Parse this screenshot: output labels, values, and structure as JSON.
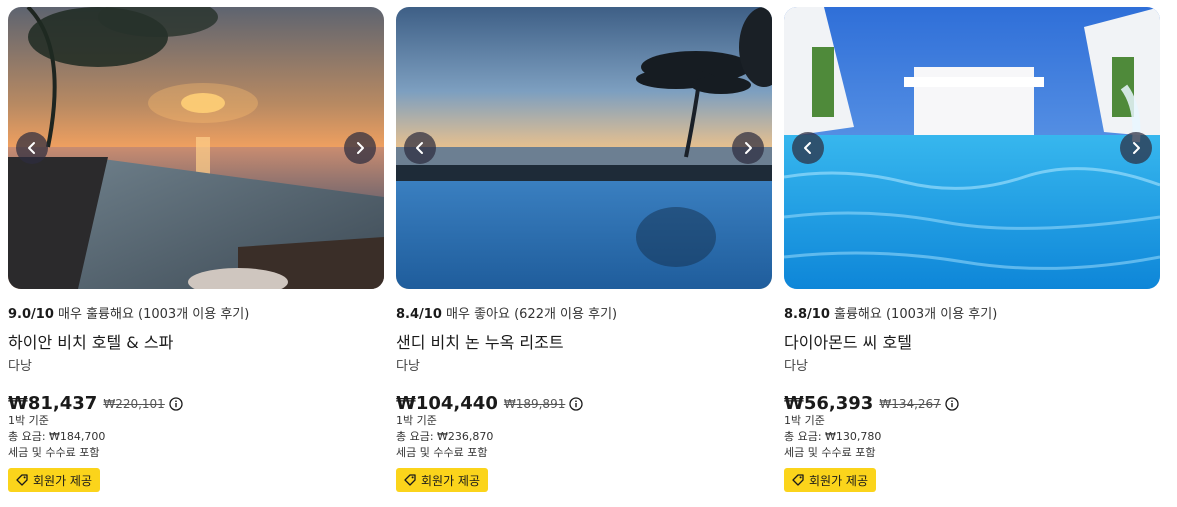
{
  "cards": [
    {
      "score": "9.0/10",
      "rating_text": "매우 훌륭해요 (1003개 이용 후기)",
      "name": "하이안 비치 호텔 & 스파",
      "city": "다낭",
      "price": "₩81,437",
      "old_price": "₩220,101",
      "per_night": "1박 기준",
      "total": "총 요금: ₩184,700",
      "tax_note": "세금 및 수수료 포함",
      "badge": "회원가 제공"
    },
    {
      "score": "8.4/10",
      "rating_text": "매우 좋아요 (622개 이용 후기)",
      "name": "샌디 비치 논 누옥 리조트",
      "city": "다낭",
      "price": "₩104,440",
      "old_price": "₩189,891",
      "per_night": "1박 기준",
      "total": "총 요금: ₩236,870",
      "tax_note": "세금 및 수수료 포함",
      "badge": "회원가 제공"
    },
    {
      "score": "8.8/10",
      "rating_text": "훌륭해요 (1003개 이용 후기)",
      "name": "다이아몬드 씨 호텔",
      "city": "다낭",
      "price": "₩56,393",
      "old_price": "₩134,267",
      "per_night": "1박 기준",
      "total": "총 요금: ₩130,780",
      "tax_note": "세금 및 수수료 포함",
      "badge": "회원가 제공"
    }
  ],
  "colors": {
    "badge_bg": "#fbd41b",
    "nav_button_bg": "#2d2d3e"
  },
  "icons": {
    "prev": "chevron-left-icon",
    "next": "chevron-right-icon",
    "info": "info-icon",
    "badge": "tag-icon"
  }
}
